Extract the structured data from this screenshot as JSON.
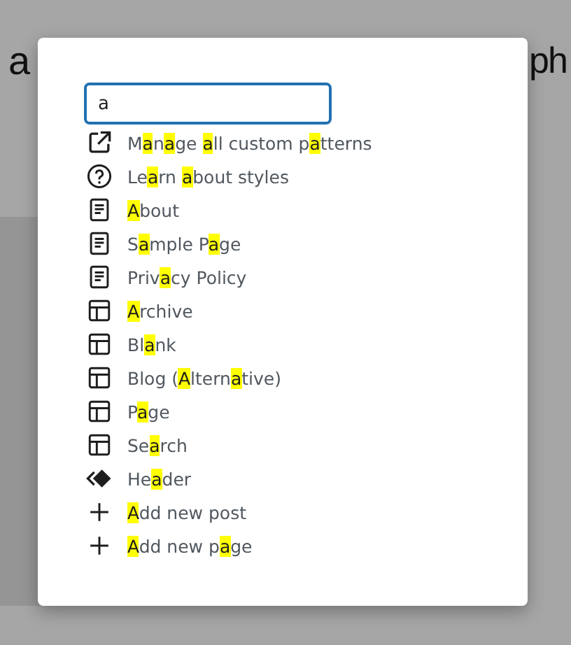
{
  "background_heading": {
    "left_text": "a",
    "right_text": "ph"
  },
  "search": {
    "value": "a"
  },
  "results": [
    {
      "kind": "external",
      "segments": [
        {
          "text": "M",
          "highlighted": false
        },
        {
          "text": "a",
          "highlighted": true
        },
        {
          "text": "n",
          "highlighted": false
        },
        {
          "text": "a",
          "highlighted": true
        },
        {
          "text": "ge ",
          "highlighted": false
        },
        {
          "text": "a",
          "highlighted": true
        },
        {
          "text": "ll custom p",
          "highlighted": false
        },
        {
          "text": "a",
          "highlighted": true
        },
        {
          "text": "tterns",
          "highlighted": false
        }
      ]
    },
    {
      "kind": "help",
      "segments": [
        {
          "text": "Le",
          "highlighted": false
        },
        {
          "text": "a",
          "highlighted": true
        },
        {
          "text": "rn ",
          "highlighted": false
        },
        {
          "text": "a",
          "highlighted": true
        },
        {
          "text": "bout styles",
          "highlighted": false
        }
      ]
    },
    {
      "kind": "page",
      "segments": [
        {
          "text": "A",
          "highlighted": true
        },
        {
          "text": "bout",
          "highlighted": false
        }
      ]
    },
    {
      "kind": "page",
      "segments": [
        {
          "text": "S",
          "highlighted": false
        },
        {
          "text": "a",
          "highlighted": true
        },
        {
          "text": "mple P",
          "highlighted": false
        },
        {
          "text": "a",
          "highlighted": true
        },
        {
          "text": "ge",
          "highlighted": false
        }
      ]
    },
    {
      "kind": "page",
      "segments": [
        {
          "text": "Priv",
          "highlighted": false
        },
        {
          "text": "a",
          "highlighted": true
        },
        {
          "text": "cy Policy",
          "highlighted": false
        }
      ]
    },
    {
      "kind": "layout",
      "segments": [
        {
          "text": "A",
          "highlighted": true
        },
        {
          "text": "rchive",
          "highlighted": false
        }
      ]
    },
    {
      "kind": "layout",
      "segments": [
        {
          "text": "Bl",
          "highlighted": false
        },
        {
          "text": "a",
          "highlighted": true
        },
        {
          "text": "nk",
          "highlighted": false
        }
      ]
    },
    {
      "kind": "layout",
      "segments": [
        {
          "text": "Blog (",
          "highlighted": false
        },
        {
          "text": "A",
          "highlighted": true
        },
        {
          "text": "ltern",
          "highlighted": false
        },
        {
          "text": "a",
          "highlighted": true
        },
        {
          "text": "tive)",
          "highlighted": false
        }
      ]
    },
    {
      "kind": "layout",
      "segments": [
        {
          "text": "P",
          "highlighted": false
        },
        {
          "text": "a",
          "highlighted": true
        },
        {
          "text": "ge",
          "highlighted": false
        }
      ]
    },
    {
      "kind": "layout",
      "segments": [
        {
          "text": "Se",
          "highlighted": false
        },
        {
          "text": "a",
          "highlighted": true
        },
        {
          "text": "rch",
          "highlighted": false
        }
      ]
    },
    {
      "kind": "pattern",
      "segments": [
        {
          "text": "He",
          "highlighted": false
        },
        {
          "text": "a",
          "highlighted": true
        },
        {
          "text": "der",
          "highlighted": false
        }
      ]
    },
    {
      "kind": "plus",
      "segments": [
        {
          "text": "A",
          "highlighted": true
        },
        {
          "text": "dd new post",
          "highlighted": false
        }
      ]
    },
    {
      "kind": "plus",
      "segments": [
        {
          "text": "A",
          "highlighted": true
        },
        {
          "text": "dd new p",
          "highlighted": false
        },
        {
          "text": "a",
          "highlighted": true
        },
        {
          "text": "ge",
          "highlighted": false
        }
      ]
    }
  ]
}
